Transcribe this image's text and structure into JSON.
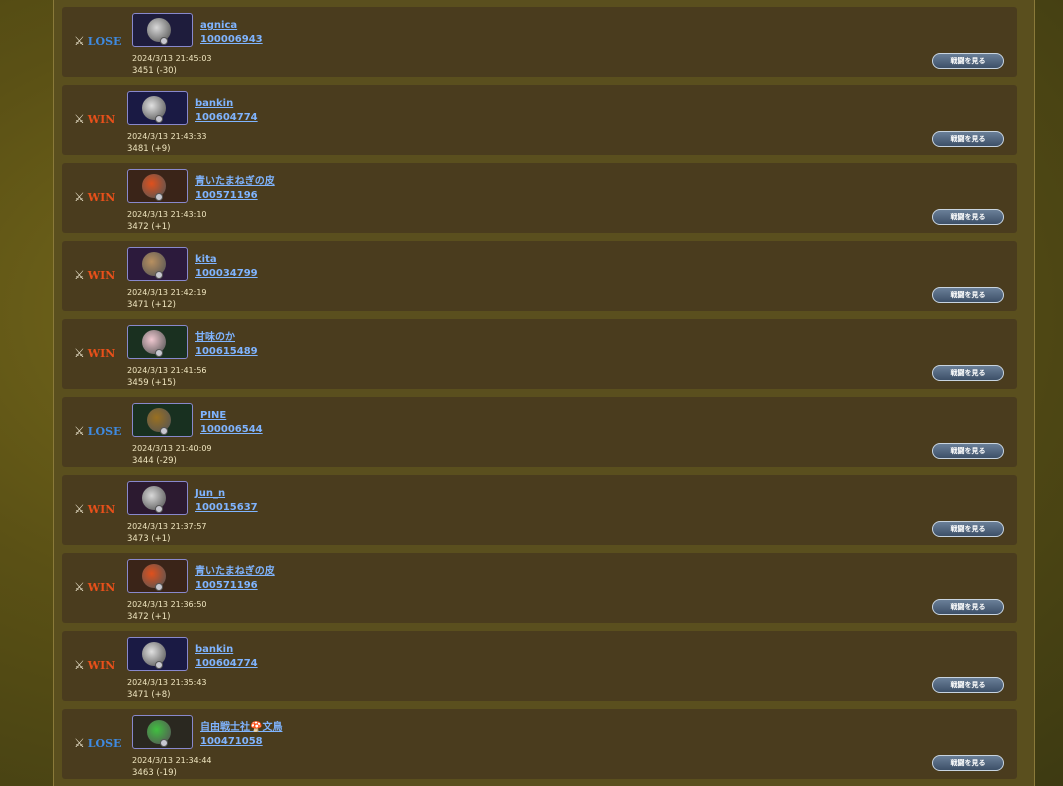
{
  "battles": [
    {
      "result": "LOSE",
      "name": "agnica",
      "id": "100006943",
      "datetime": "2024/3/13 21:45:03",
      "rating": "3451 (-30)",
      "button": "戦闘を見る",
      "avatar_color": "#1e1c3c",
      "gem_color": "#d8d8d8"
    },
    {
      "result": "WIN",
      "name": "bankin",
      "id": "100604774",
      "datetime": "2024/3/13 21:43:33",
      "rating": "3481 (+9)",
      "button": "戦闘を見る",
      "avatar_color": "#1a1a44",
      "gem_color": "#e0e0e0"
    },
    {
      "result": "WIN",
      "name": "青いたまねぎの皮",
      "id": "100571196",
      "datetime": "2024/3/13 21:43:10",
      "rating": "3472 (+1)",
      "button": "戦闘を見る",
      "avatar_color": "#3a2418",
      "gem_color": "#e0501c"
    },
    {
      "result": "WIN",
      "name": "kita",
      "id": "100034799",
      "datetime": "2024/3/13 21:42:19",
      "rating": "3471 (+12)",
      "button": "戦闘を見る",
      "avatar_color": "#2c1a3c",
      "gem_color": "#b89060"
    },
    {
      "result": "WIN",
      "name": "甘味のか",
      "id": "100615489",
      "datetime": "2024/3/13 21:41:56",
      "rating": "3459 (+15)",
      "button": "戦闘を見る",
      "avatar_color": "#1a3020",
      "gem_color": "#f0c8d0"
    },
    {
      "result": "LOSE",
      "name": "PINE",
      "id": "100006544",
      "datetime": "2024/3/13 21:40:09",
      "rating": "3444 (-29)",
      "button": "戦闘を見る",
      "avatar_color": "#183020",
      "gem_color": "#9a7020"
    },
    {
      "result": "WIN",
      "name": "Jun_n",
      "id": "100015637",
      "datetime": "2024/3/13 21:37:57",
      "rating": "3473 (+1)",
      "button": "戦闘を見る",
      "avatar_color": "#2c1a30",
      "gem_color": "#d8d8d8"
    },
    {
      "result": "WIN",
      "name": "青いたまねぎの皮",
      "id": "100571196",
      "datetime": "2024/3/13 21:36:50",
      "rating": "3472 (+1)",
      "button": "戦闘を見る",
      "avatar_color": "#3a2418",
      "gem_color": "#e0501c"
    },
    {
      "result": "WIN",
      "name": "bankin",
      "id": "100604774",
      "datetime": "2024/3/13 21:35:43",
      "rating": "3471 (+8)",
      "button": "戦闘を見る",
      "avatar_color": "#1a1a44",
      "gem_color": "#e0e0e0"
    },
    {
      "result": "LOSE",
      "name": "自由戦士社🍄文鳥",
      "id": "100471058",
      "datetime": "2024/3/13 21:34:44",
      "rating": "3463 (-19)",
      "button": "戦闘を見る",
      "avatar_color": "#2a2820",
      "gem_color": "#40c040"
    }
  ],
  "icons": {
    "result": "crossed-swords-icon",
    "avatar": "character-portrait-icon"
  },
  "colors": {
    "win": "#e8501a",
    "lose": "#3f8ae0",
    "link": "#7fb4ff",
    "row_bg": "#4a3c1e"
  }
}
